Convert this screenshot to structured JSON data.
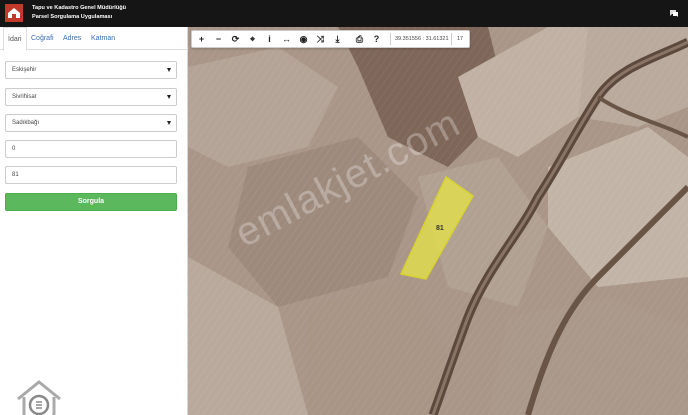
{
  "header": {
    "title_line1": "Tapu ve Kadastro Genel Müdürlüğü",
    "title_line2": "Parsel Sorgulama Uygulaması"
  },
  "sidebar": {
    "tabs": [
      {
        "label": "İdari",
        "active": true
      },
      {
        "label": "Coğrafi"
      },
      {
        "label": "Adres"
      },
      {
        "label": "Katman"
      }
    ],
    "fields": {
      "province": "Eskişehir",
      "district": "Sivrihisar",
      "neighborhood": "Sadıkbağı",
      "block": "0",
      "parcel": "81"
    },
    "submit_label": "Sorgula"
  },
  "map": {
    "toolbar": {
      "icons": [
        "plus-icon",
        "minus-icon",
        "refresh-icon",
        "crosshair-icon",
        "info-icon",
        "measure-icon",
        "eye-icon",
        "shuffle-icon",
        "download-icon",
        "print-icon",
        "help-icon"
      ],
      "coords": "39.351556 : 31.61321",
      "zoom": "17"
    },
    "parcel_label": "81",
    "watermark": "emlakjet.com",
    "parcel_color": "#e6e24a"
  }
}
